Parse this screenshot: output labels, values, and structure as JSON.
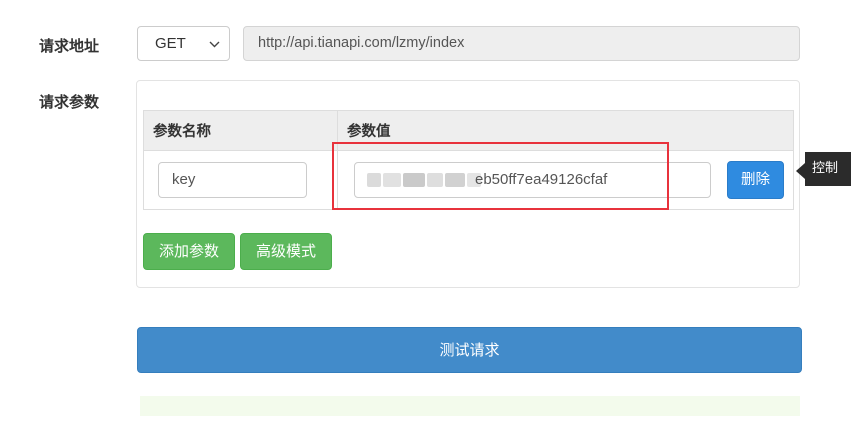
{
  "form": {
    "url_label": "请求地址",
    "params_label": "请求参数",
    "method": "GET",
    "url": "http://api.tianapi.com/lzmy/index"
  },
  "params_table": {
    "headers": [
      "参数名称",
      "参数值"
    ],
    "rows": [
      {
        "name": "key",
        "value_visible_suffix": "eb50ff7ea49126cfaf",
        "delete_label": "删除"
      }
    ]
  },
  "tooltip": {
    "text": "控制"
  },
  "actions": {
    "add_param_label": "添加参数",
    "advanced_label": "高级模式",
    "test_label": "测试请求"
  },
  "colors": {
    "primary": "#428bca",
    "danger_highlight": "#e8323c",
    "success": "#5cb85c",
    "delete_button": "#2f8be0"
  },
  "icons": {
    "method_dropdown": "chevron-down-icon"
  }
}
